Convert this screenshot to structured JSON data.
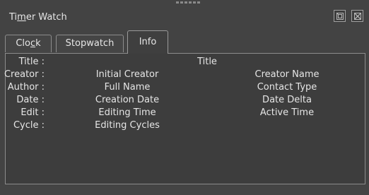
{
  "window": {
    "title_before": "Ti",
    "title_underlined": "m",
    "title_after": "er Watch",
    "float_icon": "float-window-icon",
    "close_icon": "close-window-icon"
  },
  "tabs": [
    {
      "label_before": "Clo",
      "label_underlined": "c",
      "label_after": "k",
      "active": false
    },
    {
      "label": "Stopwatch",
      "active": false
    },
    {
      "label": "Info",
      "active": true
    }
  ],
  "info": {
    "title_row": {
      "label": "Title :",
      "value": "Title"
    },
    "rows": [
      {
        "label": "Creator :",
        "col2": "Initial Creator",
        "col4": "Creator Name"
      },
      {
        "label": "Author :",
        "col2": "Full Name",
        "col4": "Contact Type"
      },
      {
        "label": "Date :",
        "col2": "Creation Date",
        "col4": "Date Delta"
      },
      {
        "label": "Edit :",
        "col2": "Editing Time",
        "col4": "Active Time"
      },
      {
        "label": "Cycle :",
        "col2": "Editing Cycles",
        "col4": ""
      }
    ]
  },
  "colors": {
    "background": "#434343",
    "content_background": "#3d3d3d",
    "border": "#8c8c8c",
    "text": "#e6e6e6"
  }
}
